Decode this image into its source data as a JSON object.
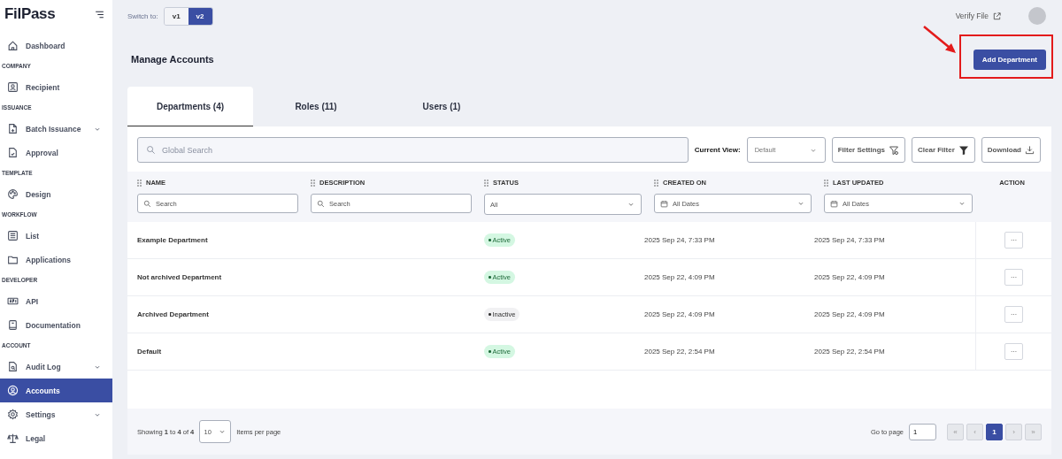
{
  "brand": {
    "logo": "FilPass"
  },
  "sidebar": {
    "sections": [
      {
        "items": [
          {
            "label": "Dashboard",
            "expandable": false,
            "selected": false
          }
        ]
      },
      {
        "title": "COMPANY",
        "items": [
          {
            "label": "Recipient",
            "expandable": false,
            "selected": false
          }
        ]
      },
      {
        "title": "ISSUANCE",
        "items": [
          {
            "label": "Batch Issuance",
            "expandable": true,
            "selected": false
          },
          {
            "label": "Approval",
            "expandable": false,
            "selected": false
          }
        ]
      },
      {
        "title": "TEMPLATE",
        "items": [
          {
            "label": "Design",
            "expandable": false,
            "selected": false
          }
        ]
      },
      {
        "title": "WORKFLOW",
        "items": [
          {
            "label": "List",
            "expandable": false,
            "selected": false
          },
          {
            "label": "Applications",
            "expandable": false,
            "selected": false
          }
        ]
      },
      {
        "title": "DEVELOPER",
        "items": [
          {
            "label": "API",
            "expandable": false,
            "selected": false
          },
          {
            "label": "Documentation",
            "expandable": false,
            "selected": false
          }
        ]
      },
      {
        "title": "ACCOUNT",
        "items": [
          {
            "label": "Audit Log",
            "expandable": true,
            "selected": false
          },
          {
            "label": "Accounts",
            "expandable": false,
            "selected": true
          },
          {
            "label": "Settings",
            "expandable": true,
            "selected": false
          },
          {
            "label": "Legal",
            "expandable": false,
            "selected": false
          }
        ]
      }
    ]
  },
  "topbar": {
    "switch_label": "Switch to:",
    "versions": [
      {
        "label": "v1",
        "selected": false
      },
      {
        "label": "v2",
        "selected": true
      }
    ],
    "verify_link": "Verify File"
  },
  "page": {
    "title": "Manage Accounts",
    "primary_button": "Add Department"
  },
  "tabs": [
    {
      "label": "Departments (4)",
      "selected": true
    },
    {
      "label": "Roles (11)",
      "selected": false
    },
    {
      "label": "Users (1)",
      "selected": false
    }
  ],
  "toolbar": {
    "search_placeholder": "Global Search",
    "view_label": "Current View:",
    "view_value": "Default",
    "buttons": [
      "Filter Settings",
      "Clear Filter",
      "Download"
    ]
  },
  "table": {
    "columns": [
      {
        "label": "NAME",
        "filter": {
          "kind": "search",
          "placeholder": "Search"
        }
      },
      {
        "label": "DESCRIPTION",
        "filter": {
          "kind": "search",
          "placeholder": "Search"
        }
      },
      {
        "label": "STATUS",
        "filter": {
          "kind": "select",
          "value": "All"
        }
      },
      {
        "label": "CREATED ON",
        "filter": {
          "kind": "date",
          "value": "All Dates"
        }
      },
      {
        "label": "LAST UPDATED",
        "filter": {
          "kind": "date",
          "value": "All Dates"
        }
      },
      {
        "label": "ACTION"
      }
    ],
    "rows": [
      {
        "name": "Example Department",
        "status": {
          "label": "Active",
          "kind": "active"
        },
        "created": "2025 Sep 24, 7:33 PM",
        "updated": "2025 Sep 24, 7:33 PM",
        "action": "···"
      },
      {
        "name": "Not archived Department",
        "status": {
          "label": "Active",
          "kind": "active"
        },
        "created": "2025 Sep 22, 4:09 PM",
        "updated": "2025 Sep 22, 4:09 PM",
        "action": "···"
      },
      {
        "name": "Archived Department",
        "status": {
          "label": "Inactive",
          "kind": "inactive"
        },
        "created": "2025 Sep 22, 4:09 PM",
        "updated": "2025 Sep 22, 4:09 PM",
        "action": "···"
      },
      {
        "name": "Default",
        "status": {
          "label": "Active",
          "kind": "active"
        },
        "created": "2025 Sep 22, 2:54 PM",
        "updated": "2025 Sep 22, 2:54 PM",
        "action": "···"
      }
    ]
  },
  "footer": {
    "showing": "Showing **1** to **4** of **4**",
    "page_size": "10",
    "page_size_label": "Items per page",
    "goto_label": "Go to page",
    "goto_value": "1",
    "pager": [
      {
        "label": "«",
        "selected": false
      },
      {
        "label": "‹",
        "selected": false
      },
      {
        "label": "1",
        "selected": true
      },
      {
        "label": "›",
        "selected": false
      },
      {
        "label": "»",
        "selected": false
      }
    ]
  }
}
